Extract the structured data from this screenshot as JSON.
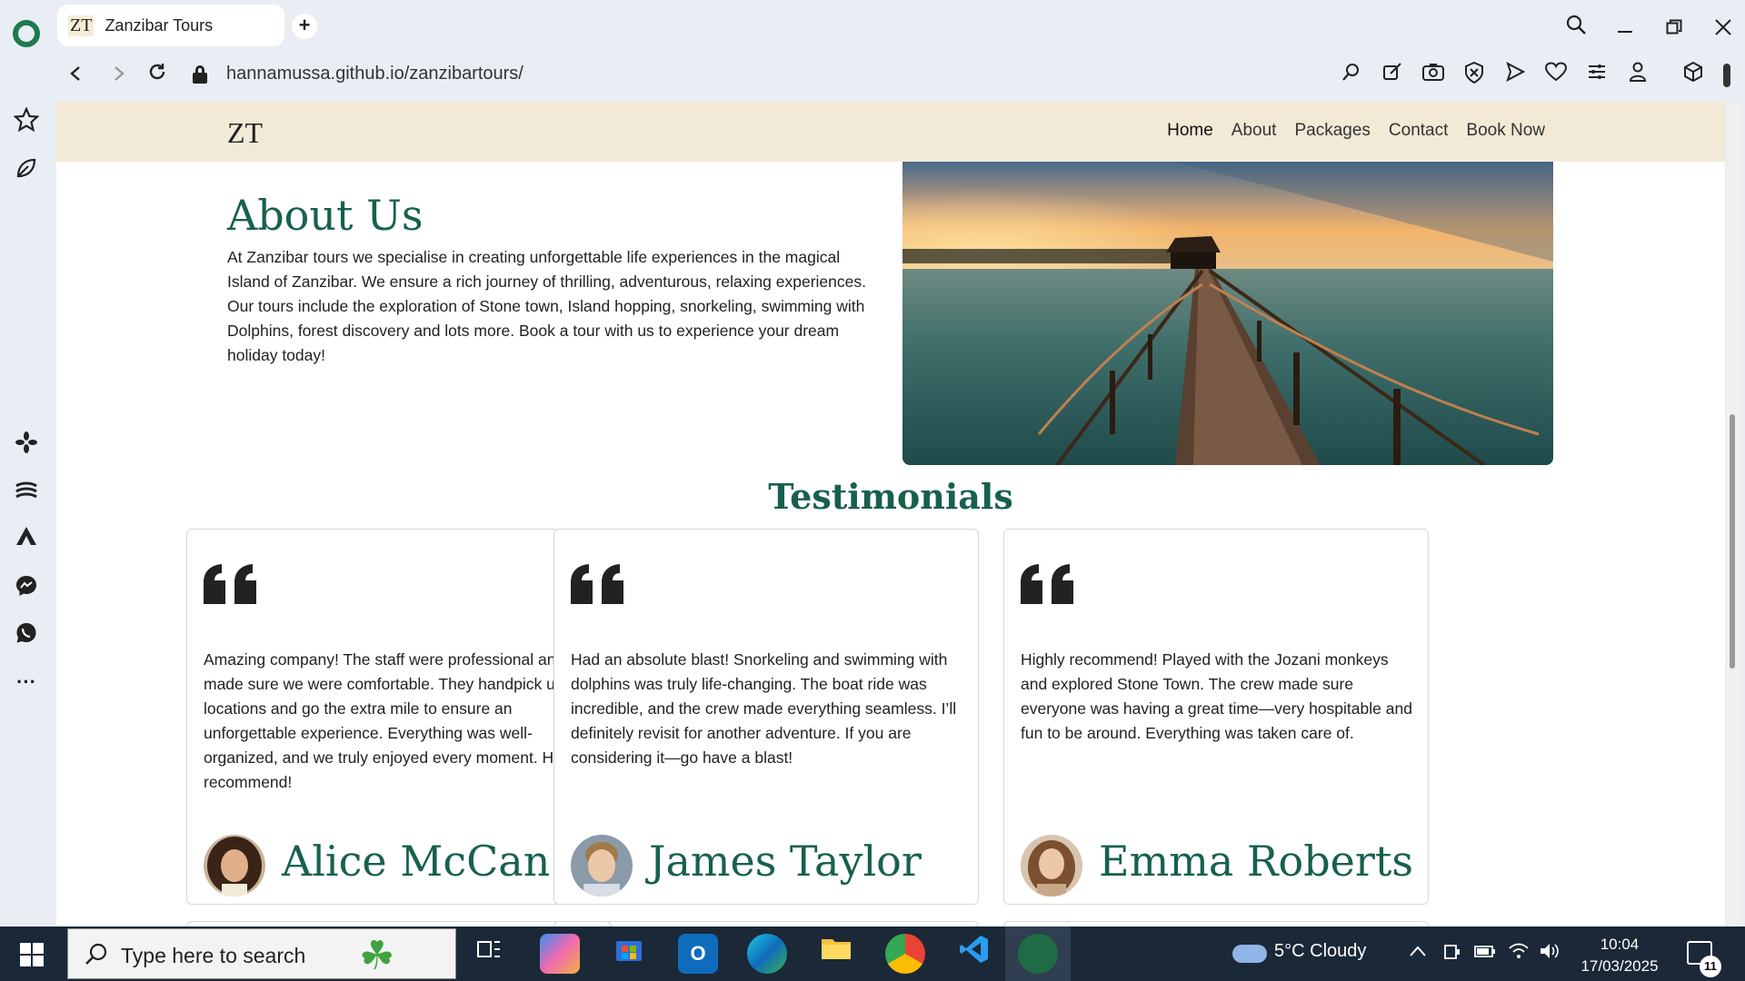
{
  "browser": {
    "tab_favicon": "ZT",
    "tab_title": "Zanzibar Tours",
    "url": "hannamussa.github.io/zanzibartours/",
    "icons": [
      "opera-logo-icon",
      "new-tab-icon",
      "search-tabs-icon",
      "minimize-icon",
      "restore-icon",
      "close-icon",
      "back-icon",
      "forward-icon",
      "reload-icon",
      "lock-icon",
      "lens-icon",
      "share-icon",
      "snapshot-icon",
      "adblock-icon",
      "send-icon",
      "heart-icon",
      "easy-setup-icon",
      "account-icon",
      "extensions-icon"
    ]
  },
  "sidebar": {
    "icons": [
      "pinboard-icon",
      "aria-icon",
      "apps-icon",
      "stack-icon",
      "aria-ai-icon",
      "messenger-icon",
      "whatsapp-icon",
      "more-icon"
    ]
  },
  "site": {
    "brand": "ZT",
    "nav": [
      "Home",
      "About",
      "Packages",
      "Contact",
      "Book Now"
    ],
    "about_title": "About Us",
    "about_text": "At Zanzibar tours we specialise in creating unforgettable life experiences in the magical Island of Zanzibar. We ensure a rich journey of thrilling, adventurous, relaxing experiences. Our tours include the exploration of Stone town, Island hopping, snorkeling, swimming with Dolphins, forest discovery and lots more. Book a tour with us to experience your dream holiday today!",
    "testimonials_title": "Testimonials",
    "testimonials": [
      {
        "text": "Amazing company! The staff were professional and made sure we were comfortable. They handpick unique locations and go the extra mile to ensure an unforgettable experience. Everything was well-organized, and we truly enjoyed every moment. Highly recommend!",
        "name": "Alice McCan"
      },
      {
        "text": "Had an absolute blast! Snorkeling and swimming with dolphins was truly life-changing. The boat ride was incredible, and the crew made everything seamless. I’ll definitely revisit for another adventure. If you are considering it—go have a blast!",
        "name": "James Taylor"
      },
      {
        "text": "Highly recommend! Played with the Jozani monkeys and explored Stone Town. The crew made sure everyone was having a great time—very hospitable and fun to be around. Everything was taken care of.",
        "name": "Emma Roberts"
      }
    ]
  },
  "taskbar": {
    "search_placeholder": "Type here to search",
    "weather": "5°C  Cloudy",
    "time": "10:04",
    "date": "17/03/2025",
    "notifications": "11",
    "apps": [
      "task-view-icon",
      "copilot-icon",
      "store-icon",
      "outlook-icon",
      "edge-icon",
      "file-explorer-icon",
      "chrome-icon",
      "vscode-icon",
      "opera-icon"
    ]
  },
  "colors": {
    "accent": "#17604f",
    "nav_bg": "#f2ead7",
    "taskbar": "#1b2838"
  }
}
